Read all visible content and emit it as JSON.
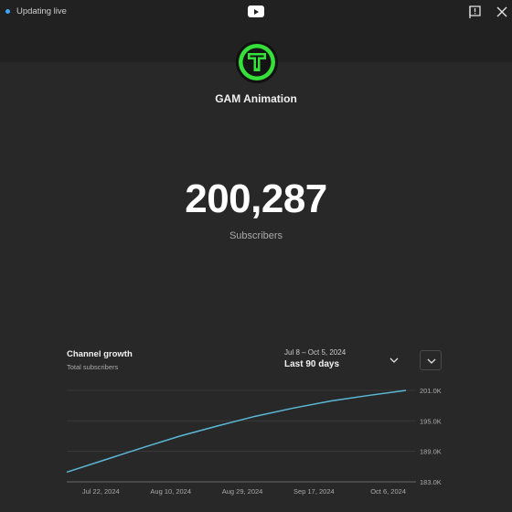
{
  "status": {
    "text": "Updating live",
    "dot_color": "#3ea6ff"
  },
  "icons": {
    "logo": "youtube-logo-icon",
    "report": "report-flag-icon",
    "close": "close-icon",
    "avatar": "gam-logo-icon",
    "range": "chevron-down-icon",
    "expand": "chevron-down-icon"
  },
  "channel": {
    "name": "GAM Animation",
    "avatar_color": "#35e03a"
  },
  "subscribers": {
    "count": "200,287",
    "label": "Subscribers"
  },
  "growth": {
    "title": "Channel growth",
    "subtitle": "Total subscribers",
    "date_range": "Jul 8 – Oct 5, 2024",
    "period": "Last 90 days"
  },
  "chart_data": {
    "type": "line",
    "title": "",
    "xlabel": "",
    "ylabel": "",
    "line_color": "#5bb8d8",
    "grid": true,
    "y_ticks": [
      183000,
      189000,
      195000,
      201000
    ],
    "y_tick_labels": [
      "183.0K",
      "189.0K",
      "195.0K",
      "201.0K"
    ],
    "ylim": [
      183000,
      201000
    ],
    "x_tick_labels": [
      "Jul 22, 2024",
      "Aug 10, 2024",
      "Aug 29, 2024",
      "Sep 17, 2024",
      "Oct 6, 2024"
    ],
    "x_ticks_day_index": [
      14,
      33,
      52,
      71,
      90
    ],
    "xlim_day_index": [
      0,
      90
    ],
    "series": [
      {
        "day_index": [
          0,
          10,
          20,
          30,
          40,
          50,
          60,
          70,
          80,
          90
        ],
        "values": [
          184900,
          187300,
          189700,
          192000,
          194000,
          195900,
          197500,
          198900,
          200000,
          201000
        ]
      }
    ]
  }
}
